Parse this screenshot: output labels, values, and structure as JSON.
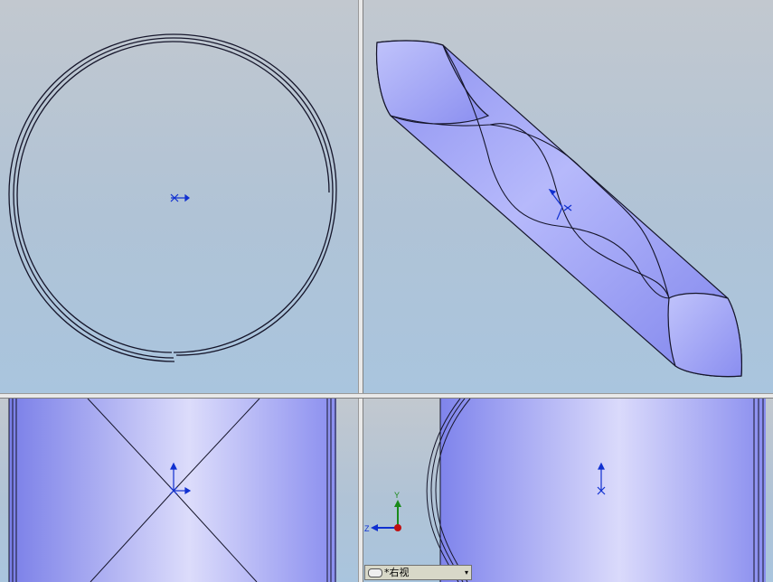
{
  "viewports": {
    "top_left": {
      "name": "top-view"
    },
    "top_right": {
      "name": "isometric-view"
    },
    "bottom_left": {
      "name": "front-view"
    },
    "bottom_right": {
      "name": "right-view",
      "label": "*右视"
    }
  },
  "triad": {
    "y_label": "Y",
    "z_label": "Z"
  },
  "colors": {
    "part_face": "#9a9ef5",
    "edge": "#1a1a2a",
    "origin": "#1030d0"
  }
}
